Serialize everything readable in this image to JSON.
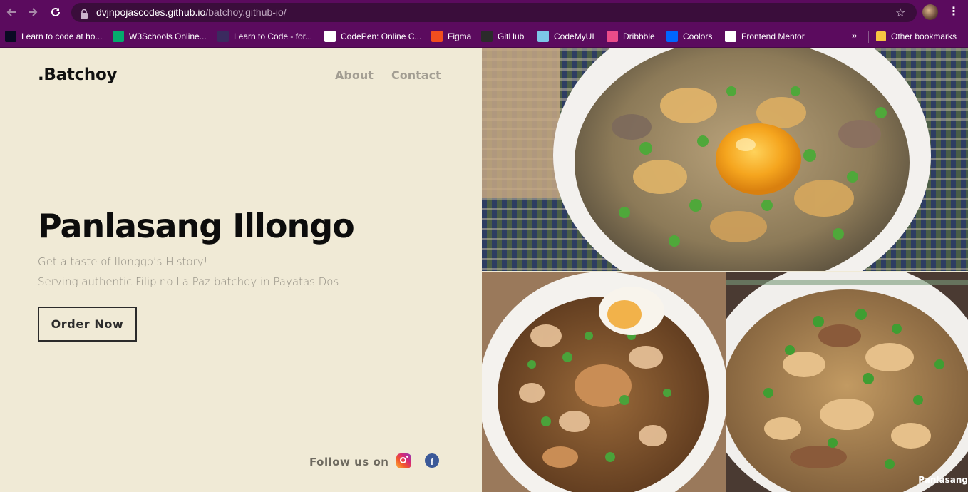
{
  "browser": {
    "url_host": "dvjnpojascodes.github.io",
    "url_path": "/batchoy.github-io/",
    "bookmarks": [
      {
        "label": "Learn to code at ho...",
        "icon": "freecodecamp-icon",
        "color": "#0a0a23"
      },
      {
        "label": "W3Schools Online...",
        "icon": "w3schools-icon",
        "color": "#04aa6d"
      },
      {
        "label": "Learn to Code - for...",
        "icon": "scrimba-icon",
        "color": "#3b2a5f"
      },
      {
        "label": "CodePen: Online C...",
        "icon": "codepen-icon",
        "color": "#ffffff"
      },
      {
        "label": "Figma",
        "icon": "figma-icon",
        "color": "#f24e1e"
      },
      {
        "label": "GitHub",
        "icon": "github-icon",
        "color": "#2b2b2b"
      },
      {
        "label": "CodeMyUI",
        "icon": "codemyui-icon",
        "color": "#7cc7e8"
      },
      {
        "label": "Dribbble",
        "icon": "dribbble-icon",
        "color": "#ea4c89"
      },
      {
        "label": "Coolors",
        "icon": "coolors-icon",
        "color": "#0066ff"
      },
      {
        "label": "Frontend Mentor",
        "icon": "frontend-mentor-icon",
        "color": "#ffffff"
      }
    ],
    "more_label": "»",
    "other_bookmarks": "Other bookmarks"
  },
  "site": {
    "logo": ".Batchoy",
    "nav": {
      "about": "About",
      "contact": "Contact"
    },
    "hero_title": "Panlasang Illongo",
    "tagline_1": "Get a taste of Ilonggo’s History!",
    "tagline_2": "Serving authentic Filipino La Paz batchoy in Payatas Dos.",
    "cta": "Order Now",
    "follow": "Follow us on",
    "watermark": "Panlasang"
  },
  "colors": {
    "chrome": "#5b0b5e",
    "page_bg": "#f0ead6",
    "nav_text": "#a39e93",
    "heading": "#0c0c0c"
  }
}
